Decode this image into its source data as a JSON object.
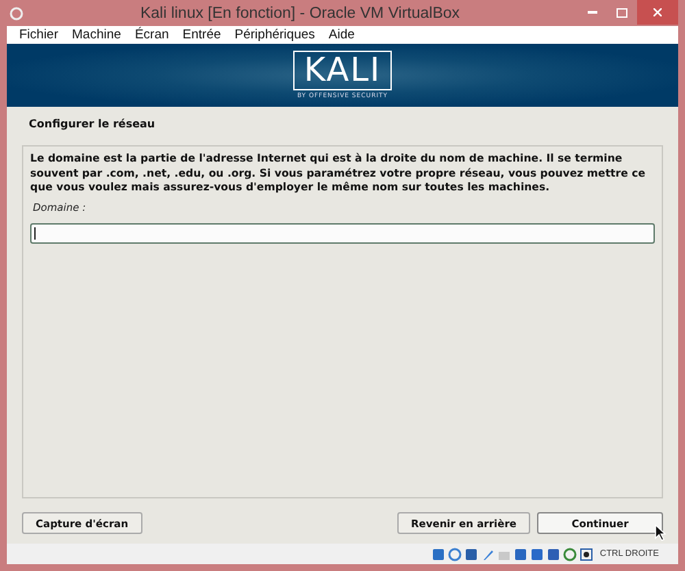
{
  "window": {
    "title": "Kali linux [En fonction] - Oracle VM VirtualBox"
  },
  "menu": [
    "Fichier",
    "Machine",
    "Écran",
    "Entrée",
    "Périphériques",
    "Aide"
  ],
  "banner": {
    "logo": "KALI",
    "tagline": "BY OFFENSIVE SECURITY"
  },
  "section_title": "Configurer le réseau",
  "description": "Le domaine est la partie de l'adresse Internet qui est à la droite du nom de machine. Il se termine souvent par .com, .net, .edu, ou .org. Si vous paramétrez votre propre réseau, vous pouvez mettre ce que vous voulez mais assurez-vous d'employer le même nom sur toutes les machines.",
  "field": {
    "label": "Domaine :",
    "focused": true
  },
  "left_buttons": [
    {
      "label": "Capture d'écran",
      "focused": false
    }
  ],
  "right_buttons": [
    {
      "label": "Revenir en arrière",
      "focused": false
    },
    {
      "label": "Continuer",
      "focused": true
    }
  ],
  "status_bar": {
    "host_key": "CTRL DROITE"
  }
}
